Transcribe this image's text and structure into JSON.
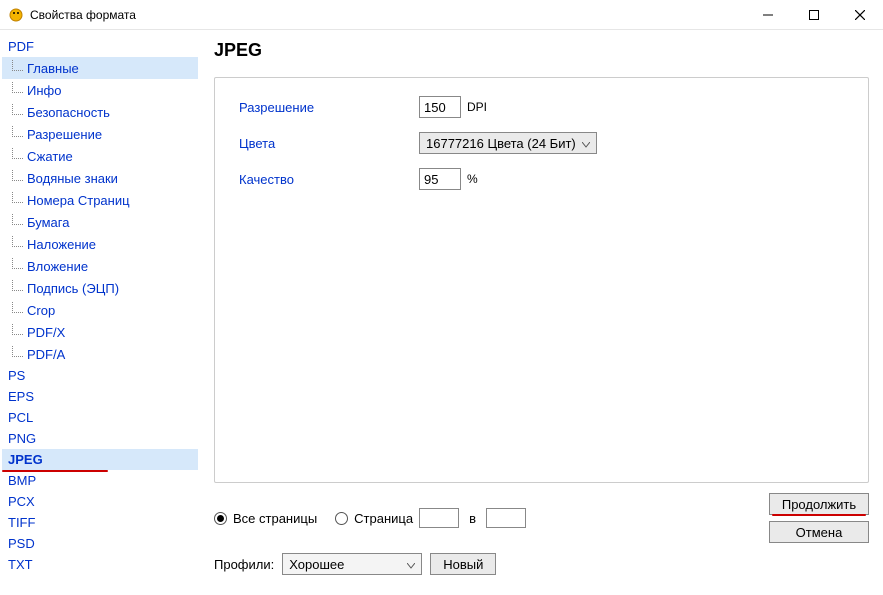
{
  "window": {
    "title": "Свойства формата"
  },
  "sidebar": {
    "items": [
      {
        "label": "PDF",
        "root": true
      },
      {
        "label": "Главные",
        "child": true,
        "selected": true
      },
      {
        "label": "Инфо",
        "child": true
      },
      {
        "label": "Безопасность",
        "child": true
      },
      {
        "label": "Разрешение",
        "child": true
      },
      {
        "label": "Сжатие",
        "child": true
      },
      {
        "label": "Водяные знаки",
        "child": true
      },
      {
        "label": "Номера Страниц",
        "child": true
      },
      {
        "label": "Бумага",
        "child": true
      },
      {
        "label": "Наложение",
        "child": true
      },
      {
        "label": "Вложение",
        "child": true
      },
      {
        "label": "Подпись   (ЭЦП)",
        "child": true
      },
      {
        "label": "Crop",
        "child": true
      },
      {
        "label": "PDF/X",
        "child": true
      },
      {
        "label": "PDF/A",
        "child": true
      },
      {
        "label": "PS",
        "root": true
      },
      {
        "label": "EPS",
        "root": true
      },
      {
        "label": "PCL",
        "root": true
      },
      {
        "label": "PNG",
        "root": true
      },
      {
        "label": "JPEG",
        "root": true,
        "active": true
      },
      {
        "label": "BMP",
        "root": true
      },
      {
        "label": "PCX",
        "root": true
      },
      {
        "label": "TIFF",
        "root": true
      },
      {
        "label": "PSD",
        "root": true
      },
      {
        "label": "TXT",
        "root": true
      }
    ]
  },
  "main": {
    "heading": "JPEG",
    "resolution": {
      "label": "Разрешение",
      "value": "150",
      "unit": "DPI"
    },
    "colors": {
      "label": "Цвета",
      "value": "16777216 Цвета (24 Бит)"
    },
    "quality": {
      "label": "Качество",
      "value": "95",
      "unit": "%"
    }
  },
  "footer": {
    "allPages": "Все страницы",
    "page": "Страница",
    "to": "в",
    "profilesLabel": "Профили:",
    "profileValue": "Хорошее",
    "newBtn": "Новый",
    "continueBtn": "Продолжить",
    "cancelBtn": "Отмена"
  }
}
